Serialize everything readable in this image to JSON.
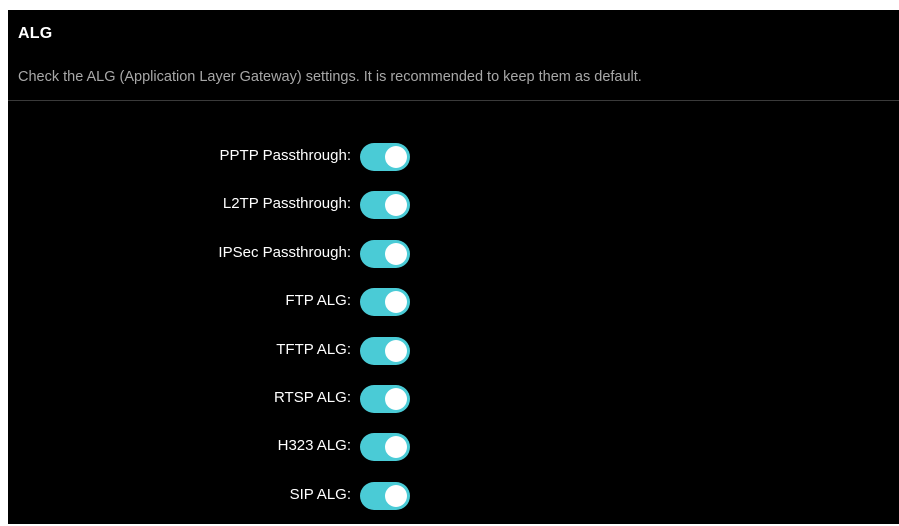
{
  "section": {
    "title": "ALG",
    "description": "Check the ALG (Application Layer Gateway) settings. It is recommended to keep them as default."
  },
  "accent_color": "#4acbd6",
  "settings": [
    {
      "key": "pptp-passthrough",
      "label": "PPTP Passthrough:",
      "enabled": true
    },
    {
      "key": "l2tp-passthrough",
      "label": "L2TP Passthrough:",
      "enabled": true
    },
    {
      "key": "ipsec-passthrough",
      "label": "IPSec Passthrough:",
      "enabled": true
    },
    {
      "key": "ftp-alg",
      "label": "FTP ALG:",
      "enabled": true
    },
    {
      "key": "tftp-alg",
      "label": "TFTP ALG:",
      "enabled": true
    },
    {
      "key": "rtsp-alg",
      "label": "RTSP ALG:",
      "enabled": true
    },
    {
      "key": "h323-alg",
      "label": "H323 ALG:",
      "enabled": true
    },
    {
      "key": "sip-alg",
      "label": "SIP ALG:",
      "enabled": true
    }
  ]
}
